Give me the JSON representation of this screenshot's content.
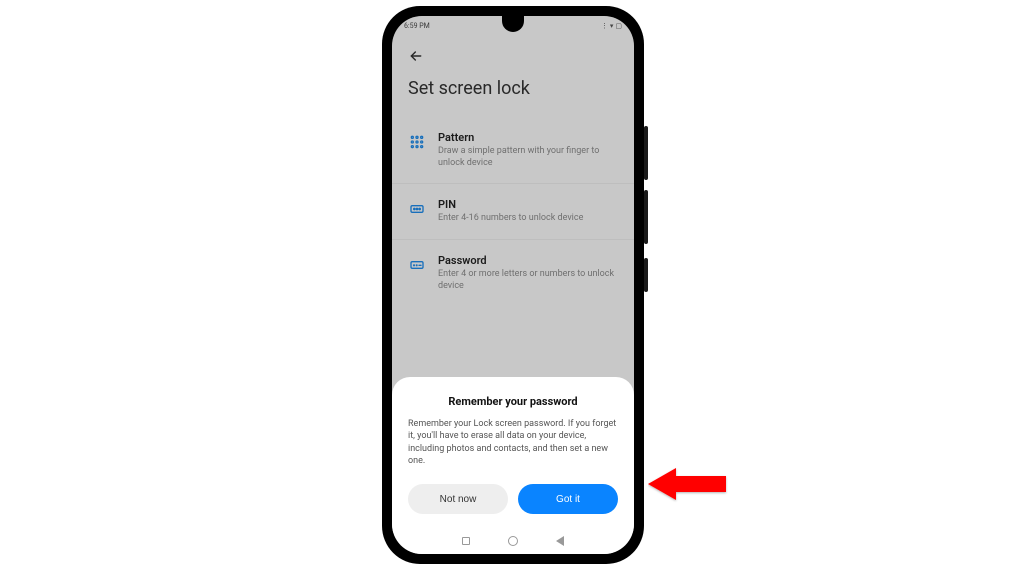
{
  "statusbar": {
    "time": "6:59 PM"
  },
  "header": {
    "title": "Set screen lock"
  },
  "options": [
    {
      "title": "Pattern",
      "desc": "Draw a simple pattern with your finger to unlock device"
    },
    {
      "title": "PIN",
      "desc": "Enter 4-16 numbers to unlock device"
    },
    {
      "title": "Password",
      "desc": "Enter 4 or more letters or numbers to unlock device"
    }
  ],
  "dialog": {
    "title": "Remember your password",
    "body": "Remember your Lock screen password. If you forget it, you'll have to erase all data on your device, including photos and contacts, and then set a new one.",
    "not_now": "Not now",
    "got_it": "Got it"
  }
}
